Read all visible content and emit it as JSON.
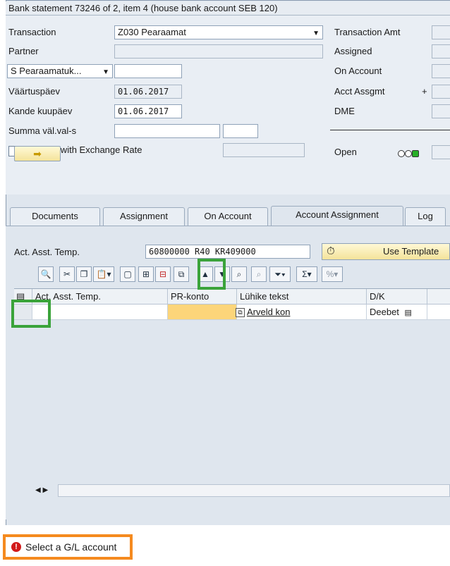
{
  "panel_title": "Bank statement 73246 of 2, item 4 (house bank account SEB 120)",
  "header": {
    "transaction_label": "Transaction",
    "transaction_value": "Z030 Pearaamat",
    "partner_label": "Partner",
    "partner_type_select": "S Pearaamatuk...",
    "vaartuspaev_label": "Väärtuspäev",
    "vaartuspaev_value": "01.06.2017",
    "kande_label": "Kande kuupäev",
    "kande_value": "01.06.2017",
    "summa_label": "Summa väl.val-s",
    "calc_label": "Calculate with Exchange Rate",
    "right": {
      "transaction_amt": "Transaction Amt",
      "assigned": "Assigned",
      "on_account": "On Account",
      "acct_assgmt": "Acct Assgmt",
      "acct_sign": "+",
      "dme": "DME",
      "open": "Open",
      "open_icon": "status-lights-icon"
    }
  },
  "tabs": [
    "Documents",
    "Assignment",
    "On Account",
    "Account Assignment",
    "Log"
  ],
  "active_tab": "Account Assignment",
  "account_assignment": {
    "template_label": "Act. Asst. Temp.",
    "template_value": "60800000 R40 KR409000",
    "use_template": "Use Template"
  },
  "toolbar_icons": [
    "details-icon",
    "cut-icon",
    "copy-icon",
    "paste-icon",
    "new-row-icon",
    "insert-row-icon",
    "delete-row-icon",
    "copy-row-icon",
    "sort-asc-icon",
    "sort-desc-icon",
    "find-icon",
    "find-next-icon",
    "filter-icon",
    "sum-icon",
    "subtotal-icon"
  ],
  "table": {
    "columns": [
      "Act. Asst. Temp.",
      "PR-konto",
      "Lühike tekst",
      "D/K"
    ],
    "rows": [
      {
        "template": "",
        "pr_konto": "",
        "text": "Arveld kon",
        "dk": "Deebet"
      }
    ]
  },
  "status_bar": {
    "message": "Select a G/L account",
    "type": "error"
  },
  "colors": {
    "highlight_green": "#3aa33a",
    "highlight_orange": "#f58a1f",
    "required_field": "#fcd57a",
    "error": "#d21a1a"
  }
}
